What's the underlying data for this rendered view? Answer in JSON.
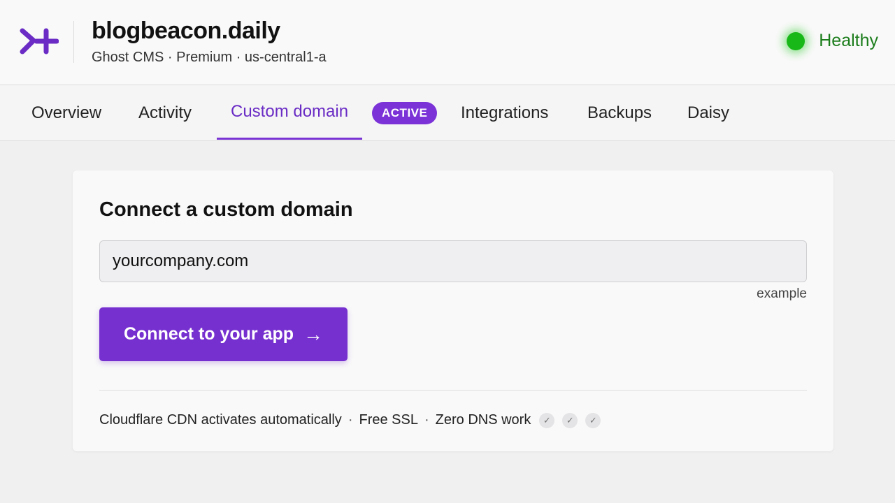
{
  "header": {
    "site_name": "blogbeacon.daily",
    "site_meta": "Ghost CMS · Premium · us-central1-a",
    "status_label": "Healthy",
    "logo_icon": "brand-logo-icon",
    "status_color": "#18b818"
  },
  "tabs": [
    {
      "label": "Overview"
    },
    {
      "label": "Activity"
    },
    {
      "label": "Custom domain",
      "badge": "ACTIVE",
      "active": true
    },
    {
      "label": "Integrations"
    },
    {
      "label": "Backups"
    },
    {
      "label": "Daisy"
    }
  ],
  "card": {
    "title": "Connect a custom domain",
    "input_value": "yourcompany.com",
    "input_hint": "example",
    "button_label": "Connect to your app",
    "button_icon": "arrow-right-icon",
    "features": [
      "Cloudflare CDN activates automatically",
      "Free SSL",
      "Zero DNS work"
    ],
    "separator": "·",
    "check_icon": "check-icon"
  },
  "colors": {
    "accent": "#7630cf",
    "active_tab": "#6a2cc4",
    "healthy_text": "#1c7d1c"
  }
}
